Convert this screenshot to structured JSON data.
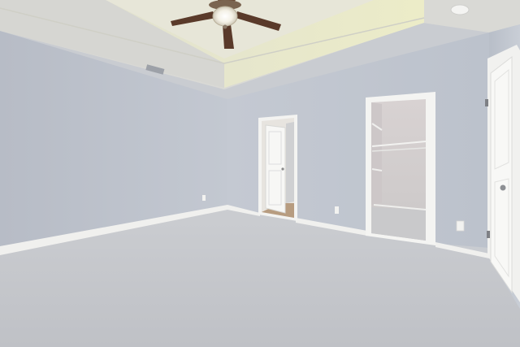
{
  "scene": {
    "kind": "empty-bedroom-interior",
    "features": [
      "tray-ceiling",
      "ceiling-fan",
      "carpet-floor",
      "walk-in-closet",
      "open-doorway",
      "bedroom-door"
    ],
    "colors": {
      "wall": "#b9bfca",
      "wall_light": "#c6cbd4",
      "ceiling": "#dcdcd6",
      "tray": "#e6e6c9",
      "carpet": "#c5c7cb",
      "trim": "#f2f2f0",
      "fan_blade": "#5a3a2a"
    }
  }
}
